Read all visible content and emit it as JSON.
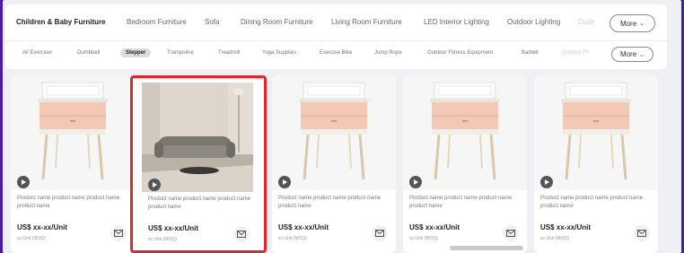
{
  "colors": {
    "backdrop": "#4a1e9e",
    "selection_border": "#e4262b",
    "product_drawer": "#f3c9b5",
    "product_top": "#f8f8f8",
    "product_legs": "#d8c9a8"
  },
  "category_tabs": [
    {
      "label": "Children & Baby Furniture",
      "active": true
    },
    {
      "label": "Bedroom Furniture"
    },
    {
      "label": "Sofa"
    },
    {
      "label": "Dining Room Furniture"
    },
    {
      "label": "Living Room Furniture"
    },
    {
      "label": "LED Interior Lighting"
    },
    {
      "label": "Outdoor Lighting"
    },
    {
      "label": "Dush",
      "faded": true
    }
  ],
  "category_more": "More",
  "sub_tabs": [
    {
      "label": "All Exerciser"
    },
    {
      "label": "Dumbbell"
    },
    {
      "label": "Stepper",
      "active": true
    },
    {
      "label": "Trampoline"
    },
    {
      "label": "Treadmill"
    },
    {
      "label": "Yoga Supplies"
    },
    {
      "label": "Exercise Bike"
    },
    {
      "label": "Jump Rope"
    },
    {
      "label": "Outdoor Fitness Equipment"
    },
    {
      "label": "Barbell"
    },
    {
      "label": "Outdoor Fit",
      "faded": true
    }
  ],
  "sub_more": "More",
  "products": [
    {
      "image": "nightstand",
      "has_video": true,
      "name": "Product name product name product name product name",
      "price": "US$ xx-xx/Unit",
      "moq": "xx Unit (MOQ)",
      "selected": false
    },
    {
      "image": "sofa",
      "has_video": true,
      "name": "Product name product name product name product name",
      "price": "US$ xx-xx/Unit",
      "moq": "xx Unit (MOQ)",
      "selected": true
    },
    {
      "image": "nightstand",
      "has_video": true,
      "name": "Product name product name product name product name",
      "price": "US$ xx-xx/Unit",
      "moq": "xx Unit (MOQ)",
      "selected": false
    },
    {
      "image": "nightstand",
      "has_video": true,
      "name": "Product name product name product name product name",
      "price": "US$ xx-xx/Unit",
      "moq": "xx Unit (MOQ)",
      "selected": false
    },
    {
      "image": "nightstand",
      "has_video": true,
      "name": "Product name product name product name product name",
      "price": "US$ xx-xx/Unit",
      "moq": "xx Unit (MOQ)",
      "selected": false
    }
  ]
}
